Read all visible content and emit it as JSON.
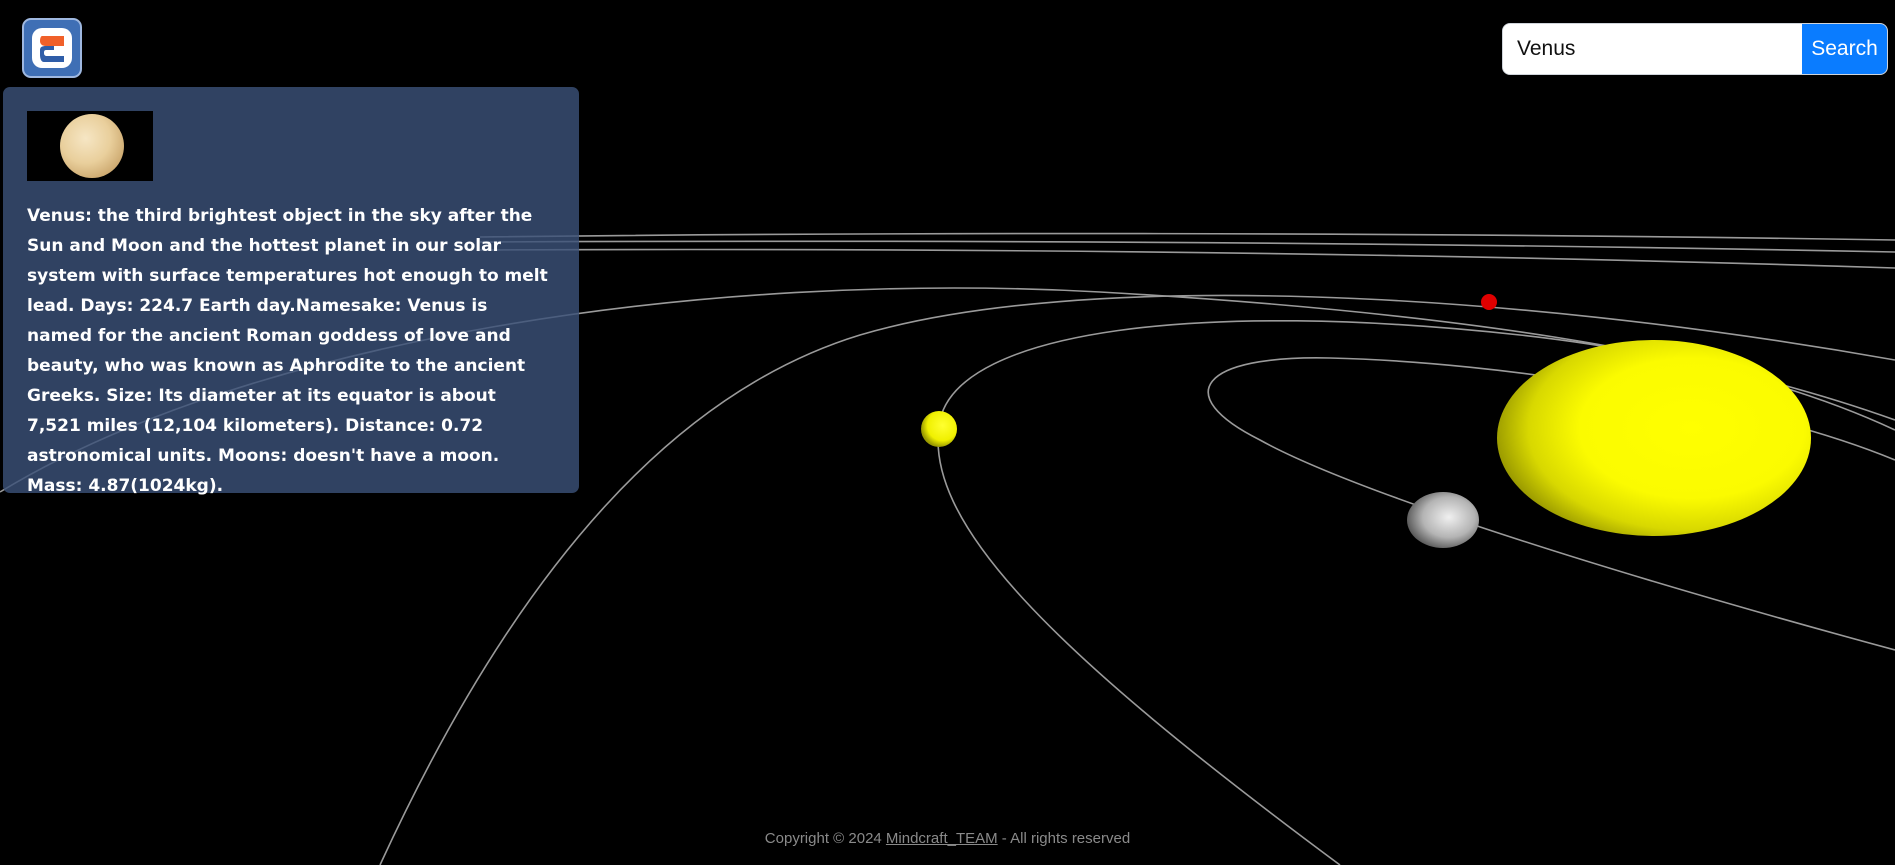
{
  "search": {
    "value": "Venus",
    "button_label": "Search"
  },
  "info_panel": {
    "image_icon": "venus-thumbnail",
    "description": "Venus: the third brightest object in the sky after the Sun and Moon and the hottest planet in our solar system with surface temperatures hot enough to melt lead. Days: 224.7 Earth day.Namesake: Venus is named for the ancient Roman goddess of love and beauty, who was known as Aphrodite to the ancient Greeks. Size: Its diameter at its equator is about 7,521 miles (12,104 kilometers). Distance: 0.72 astronomical units. Moons: doesn't have a moon. Mass: 4.87(1024kg)."
  },
  "footer": {
    "prefix": "Copyright © 2024",
    "link_text": "Mindcraft_TEAM",
    "suffix": "- All rights reserved"
  },
  "colors": {
    "accent": "#0a7cff",
    "panel": "#3a5078",
    "sun": "#ffff00",
    "orbit": "#9a9a9a",
    "mars_dot": "#e00000"
  }
}
